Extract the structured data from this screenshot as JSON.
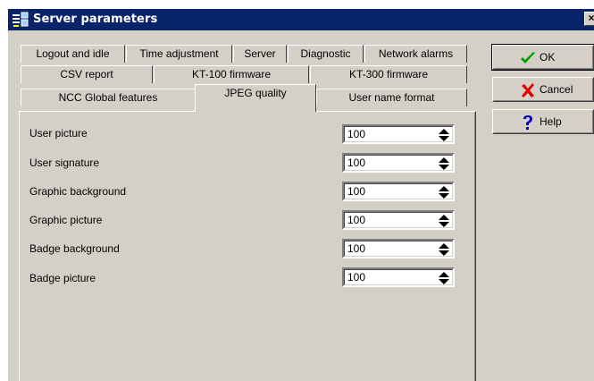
{
  "window": {
    "title": "Server parameters",
    "close_glyph": "×"
  },
  "tabs": {
    "row1": [
      "Logout and idle",
      "Time adjustment",
      "Server",
      "Diagnostic",
      "Network alarms"
    ],
    "row2": [
      "CSV report",
      "KT-100 firmware",
      "KT-300 firmware"
    ],
    "row3": [
      "NCC Global features",
      "JPEG quality",
      "User name format"
    ],
    "active": "JPEG quality"
  },
  "fields": [
    {
      "label": "User picture",
      "value": "100"
    },
    {
      "label": "User signature",
      "value": "100"
    },
    {
      "label": "Graphic background",
      "value": "100"
    },
    {
      "label": "Graphic picture",
      "value": "100"
    },
    {
      "label": "Badge background",
      "value": "100"
    },
    {
      "label": "Badge picture",
      "value": "100"
    }
  ],
  "buttons": {
    "ok": {
      "label": "OK",
      "icon": "checkmark-icon",
      "color": "#00a000"
    },
    "cancel": {
      "label": "Cancel",
      "icon": "x-icon",
      "color": "#e00000"
    },
    "help": {
      "label": "Help",
      "icon": "question-icon",
      "color": "#0000c8"
    }
  }
}
